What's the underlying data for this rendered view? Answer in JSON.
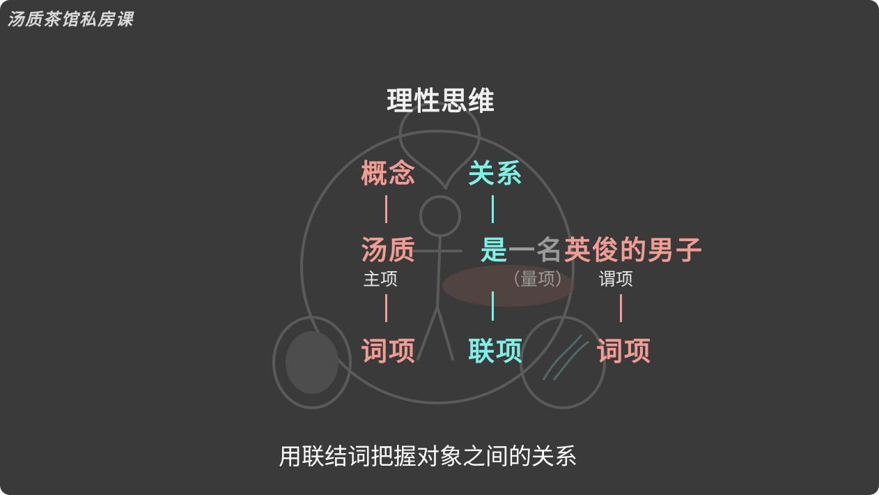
{
  "watermark": "汤质茶馆私房课",
  "title": "理性思维",
  "nodes": {
    "concept": "概念",
    "relation": "关系",
    "subject_word": "汤质",
    "copula_word": "是",
    "quantifier_word": "一名",
    "predicate_word": "英俊的男子",
    "subject_role": "主项",
    "quantifier_role": "（量项）",
    "predicate_role": "谓项",
    "term_left": "词项",
    "copula_term": "联项",
    "term_right": "词项"
  },
  "subtitle": "用联结词把握对象之间的关系",
  "colors": {
    "background": "#3a3a3a",
    "term": "#f29d94",
    "relation": "#7ff0e6",
    "quantifier": "#9a9a9a",
    "text": "#ffffff"
  }
}
